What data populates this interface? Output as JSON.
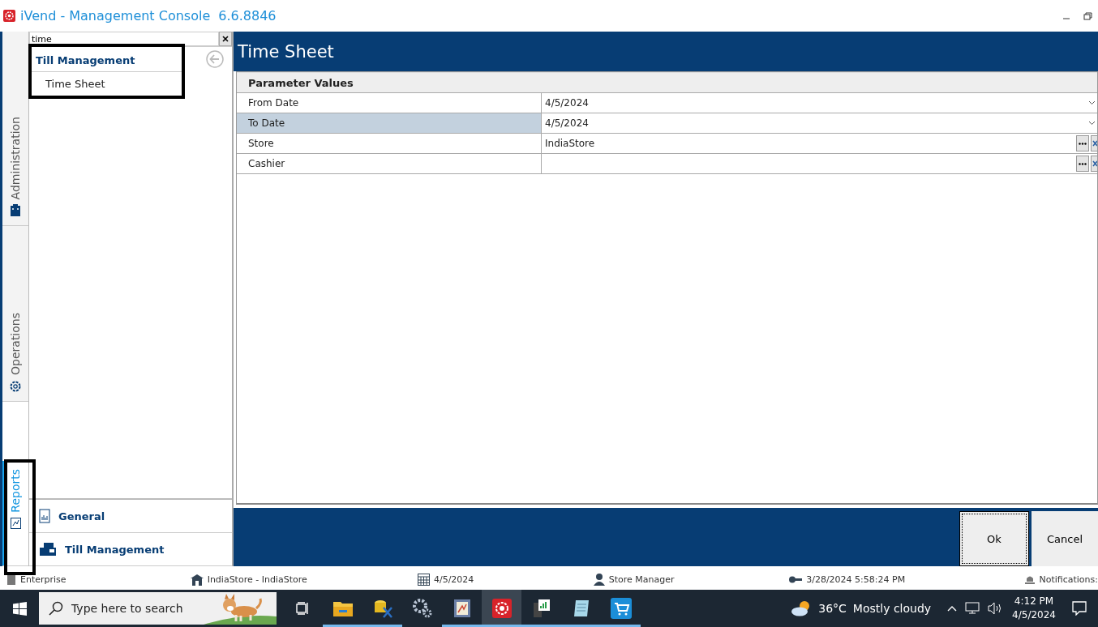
{
  "window": {
    "title": "iVend - Management Console",
    "version": "6.6.8846"
  },
  "side_tabs": [
    {
      "label": "Administration",
      "kind": "admin",
      "selected": false
    },
    {
      "label": "Operations",
      "kind": "operations",
      "selected": false
    },
    {
      "label": "Reports",
      "kind": "reports",
      "selected": true
    }
  ],
  "nav": {
    "search": {
      "value": "time"
    },
    "tree": [
      {
        "label": "Till Management",
        "children": [
          {
            "label": "Time Sheet"
          }
        ]
      }
    ],
    "sections": [
      {
        "label": "General",
        "kind": "general"
      },
      {
        "label": "Till Management",
        "kind": "till"
      }
    ]
  },
  "content": {
    "title": "Time Sheet",
    "grid": {
      "header": "Parameter Values",
      "rows": [
        {
          "label": "From Date",
          "value": "4/5/2024",
          "kind": "date",
          "selected": false
        },
        {
          "label": "To Date",
          "value": "4/5/2024",
          "kind": "date",
          "selected": true
        },
        {
          "label": "Store",
          "value": "IndiaStore",
          "kind": "lookup",
          "selected": false
        },
        {
          "label": "Cashier",
          "kind": "lookup",
          "selected": false
        }
      ]
    },
    "buttons": [
      {
        "label": "Ok",
        "focused": true
      },
      {
        "label": "Cancel",
        "focused": false
      }
    ]
  },
  "status_bar": [
    {
      "kind": "company",
      "text": "Enterprise"
    },
    {
      "kind": "store",
      "text": "IndiaStore - IndiaStore"
    },
    {
      "kind": "date",
      "text": "4/5/2024"
    },
    {
      "kind": "user",
      "text": "Store Manager"
    },
    {
      "kind": "login",
      "text": "3/28/2024 5:58:24 PM"
    },
    {
      "kind": "notifications",
      "text": "Notifications:"
    }
  ],
  "taskbar": {
    "search_placeholder": "Type here to search",
    "apps": [
      {
        "kind": "task-view",
        "running": false,
        "active": false
      },
      {
        "kind": "folder",
        "running": true,
        "active": false
      },
      {
        "kind": "database",
        "running": true,
        "active": false
      },
      {
        "kind": "gears",
        "running": false,
        "active": false
      },
      {
        "kind": "chart",
        "running": true,
        "active": false
      },
      {
        "kind": "ivend",
        "running": true,
        "active": true
      },
      {
        "kind": "server",
        "running": true,
        "active": false
      },
      {
        "kind": "notepad",
        "running": true,
        "active": false
      },
      {
        "kind": "cart",
        "running": true,
        "active": false
      }
    ],
    "weather": {
      "temperature": "36°C",
      "condition": "Mostly cloudy"
    },
    "time": "4:12 PM",
    "date": "4/5/2024"
  }
}
